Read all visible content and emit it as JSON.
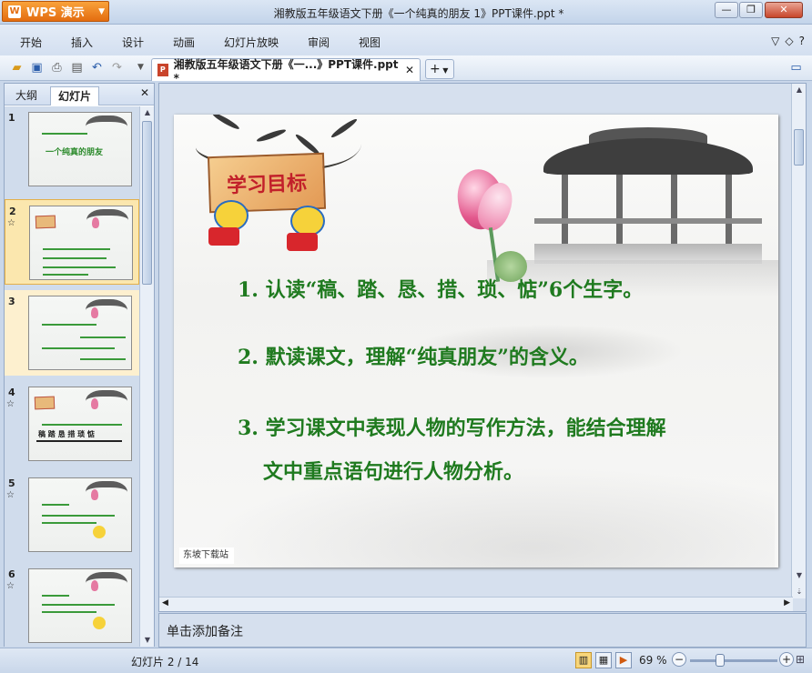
{
  "app": {
    "name": "WPS 演示",
    "logo": "W"
  },
  "window": {
    "title": "湘教版五年级语文下册《一个纯真的朋友 1》PPT课件.ppt *",
    "minimize": "—",
    "restore": "❐",
    "close": "✕"
  },
  "menu": [
    "开始",
    "插入",
    "设计",
    "动画",
    "幻灯片放映",
    "审阅",
    "视图"
  ],
  "menu_right": {
    "collapse": "▽",
    "help": "?",
    "skin": "◇"
  },
  "doc_tab": {
    "label": "湘教版五年级语文下册《一...》PPT课件.ppt *",
    "close": "✕",
    "new": "+"
  },
  "left_panel": {
    "tab_outline": "大纲",
    "tab_slides": "幻灯片",
    "close": "✕",
    "slides": [
      {
        "num": "1",
        "star": "",
        "title": "一个纯真的朋友"
      },
      {
        "num": "2",
        "star": "☆",
        "title": ""
      },
      {
        "num": "3",
        "star": "",
        "title": ""
      },
      {
        "num": "4",
        "star": "☆",
        "title": "稿 踏 恳 措 琐 惦"
      },
      {
        "num": "5",
        "star": "☆",
        "title": ""
      },
      {
        "num": "6",
        "star": "☆",
        "title": ""
      }
    ]
  },
  "slide": {
    "sign_text": "学习目标",
    "goals": [
      "1. 认读“稿、踏、恳、措、琐、惦”6个生字。",
      "2. 默读课文，理解“纯真朋友”的含义。",
      "3. 学习课文中表现人物的写作方法，能结合理解",
      "文中重点语句进行人物分析。"
    ],
    "footer": "东坡下载站"
  },
  "notes_placeholder": "单击添加备注",
  "status": {
    "slide_count": "幻灯片 2 / 14",
    "zoom": "69 %",
    "zoom_out": "−",
    "zoom_in": "+"
  },
  "colors": {
    "goal_text": "#1f7a1f",
    "sign_text": "#c2202a",
    "app_button": "#e46d10"
  }
}
